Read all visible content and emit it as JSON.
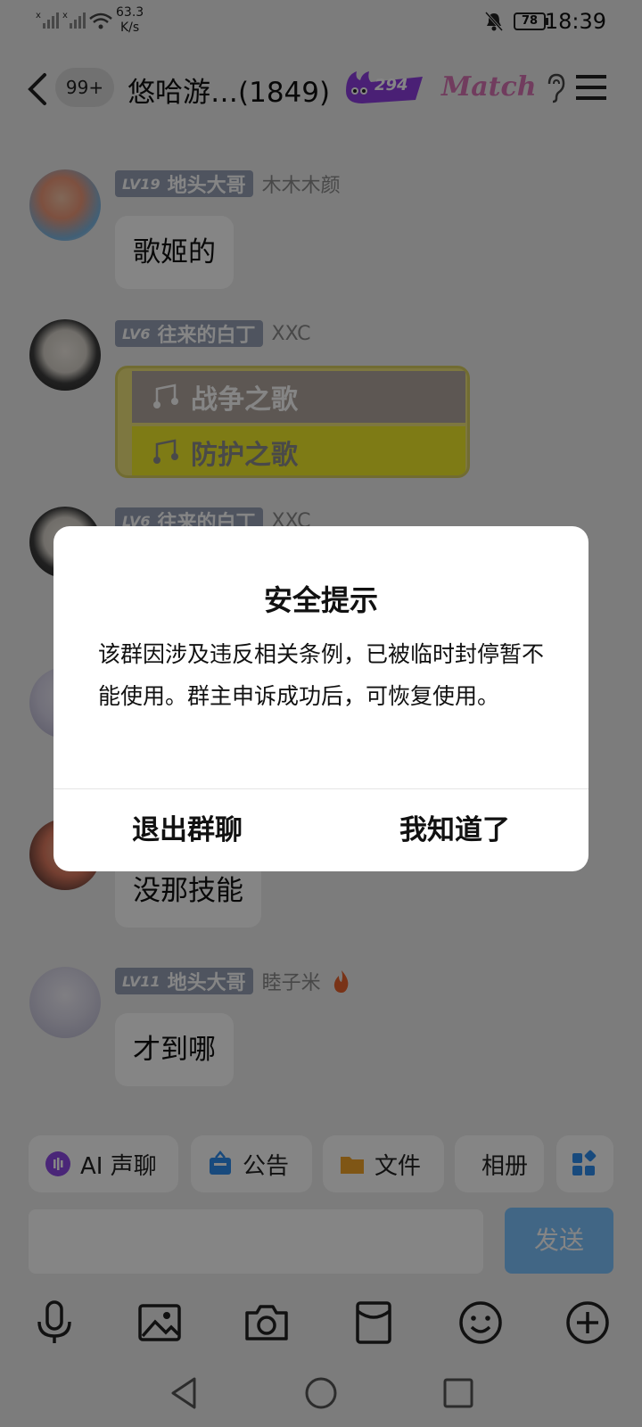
{
  "status_bar": {
    "net_speed_value": "63.3",
    "net_speed_unit": "K/s",
    "battery": "78",
    "time": "18:39",
    "icons": [
      "signal-icon",
      "signal-icon",
      "wifi-icon",
      "bell-off-icon",
      "battery-icon"
    ]
  },
  "header": {
    "unread_badge": "99+",
    "title": "悠哈游…(1849)",
    "fire_count": "294",
    "match_logo": "Match",
    "icons": [
      "back-icon",
      "fire-icon",
      "ear-icon",
      "menu-icon"
    ]
  },
  "messages": [
    {
      "level": "LV19",
      "title": "地头大哥",
      "nickname": "木木木颜",
      "text": "歌姬的"
    },
    {
      "level": "LV6",
      "title": "往来的白丁",
      "nickname": "XXC",
      "image_rows": [
        "战争之歌",
        "防护之歌"
      ]
    },
    {
      "level": "LV6",
      "title": "往来的白丁",
      "nickname": "XXC"
    },
    {
      "text": "没那技能"
    },
    {
      "level": "LV11",
      "title": "地头大哥",
      "nickname": "睦子米",
      "text": "才到哪"
    }
  ],
  "quick_actions": [
    {
      "label": "AI 声聊",
      "icon": "ai-voice-icon"
    },
    {
      "label": "公告",
      "icon": "announcement-icon"
    },
    {
      "label": "文件",
      "icon": "folder-icon"
    },
    {
      "label": "相册",
      "icon": "album-icon"
    }
  ],
  "input": {
    "send_label": "发送"
  },
  "toolbar_icons": [
    "microphone-icon",
    "image-icon",
    "camera-icon",
    "red-packet-icon",
    "emoji-icon",
    "plus-icon"
  ],
  "nav_icons": [
    "nav-back-icon",
    "nav-home-icon",
    "nav-recent-icon"
  ],
  "dialog": {
    "title": "安全提示",
    "body": "该群因涉及违反相关条例，已被临时封停暂不能使用。群主申诉成功后，可恢复使用。",
    "left_button": "退出群聊",
    "right_button": "我知道了"
  },
  "colors": {
    "send_button": "#7ec3ff",
    "level_tag": "#97a1b7",
    "match_logo": "#d874b4",
    "fire_badge": "#8e3fe0"
  }
}
